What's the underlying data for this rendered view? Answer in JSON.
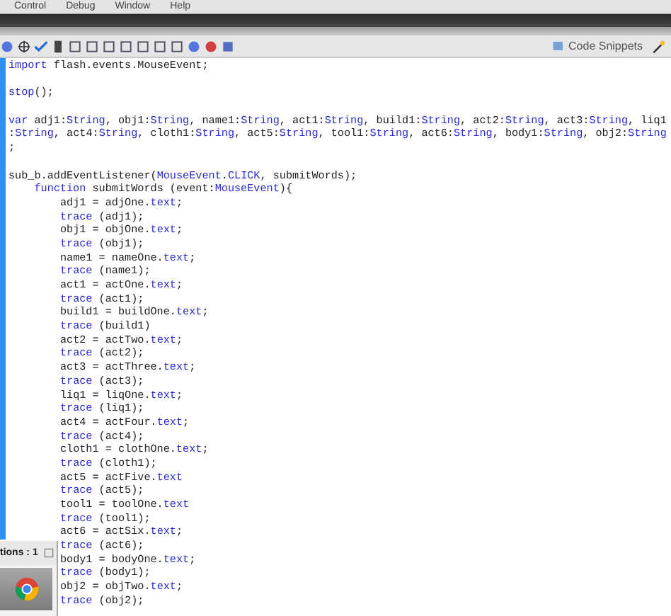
{
  "menu": [
    "Control",
    "Debug",
    "Window",
    "Help"
  ],
  "toolbar": {
    "snippets_label": "Code Snippets"
  },
  "code_blocks": [
    [
      {
        "segments": [
          {
            "text": "import",
            "keyword": true
          },
          {
            "text": " flash.events.MouseEvent;",
            "keyword": false
          }
        ]
      }
    ],
    [
      {
        "segments": [
          {
            "text": "stop",
            "keyword": true
          },
          {
            "text": "();",
            "keyword": false
          }
        ]
      }
    ],
    [
      {
        "segments": [
          {
            "text": "var",
            "keyword": true
          },
          {
            "text": " adj1:",
            "keyword": false
          },
          {
            "text": "String",
            "keyword": true
          },
          {
            "text": ", obj1:",
            "keyword": false
          },
          {
            "text": "String",
            "keyword": true
          },
          {
            "text": ", name1:",
            "keyword": false
          },
          {
            "text": "String",
            "keyword": true
          },
          {
            "text": ", act1:",
            "keyword": false
          },
          {
            "text": "String",
            "keyword": true
          },
          {
            "text": ", build1:",
            "keyword": false
          },
          {
            "text": "String",
            "keyword": true
          },
          {
            "text": ", act2:",
            "keyword": false
          },
          {
            "text": "String",
            "keyword": true
          },
          {
            "text": ", act3:",
            "keyword": false
          },
          {
            "text": "String",
            "keyword": true
          },
          {
            "text": ", liq1",
            "keyword": false
          }
        ]
      },
      {
        "segments": [
          {
            "text": ":",
            "keyword": false
          },
          {
            "text": "String",
            "keyword": true
          },
          {
            "text": ", act4:",
            "keyword": false
          },
          {
            "text": "String",
            "keyword": true
          },
          {
            "text": ", cloth1:",
            "keyword": false
          },
          {
            "text": "String",
            "keyword": true
          },
          {
            "text": ", act5:",
            "keyword": false
          },
          {
            "text": "String",
            "keyword": true
          },
          {
            "text": ", tool1:",
            "keyword": false
          },
          {
            "text": "String",
            "keyword": true
          },
          {
            "text": ", act6:",
            "keyword": false
          },
          {
            "text": "String",
            "keyword": true
          },
          {
            "text": ", body1:",
            "keyword": false
          },
          {
            "text": "String",
            "keyword": true
          },
          {
            "text": ", obj2:",
            "keyword": false
          },
          {
            "text": "String",
            "keyword": true
          }
        ]
      },
      {
        "segments": [
          {
            "text": ";",
            "keyword": false
          }
        ]
      }
    ],
    [
      {
        "segments": [
          {
            "text": "sub_b.addEventListener(",
            "keyword": false
          },
          {
            "text": "MouseEvent",
            "keyword": true
          },
          {
            "text": ".",
            "keyword": false
          },
          {
            "text": "CLICK",
            "keyword": true
          },
          {
            "text": ", submitWords);",
            "keyword": false
          }
        ],
        "children": [
          {
            "segments": [
              {
                "text": "function",
                "keyword": true
              },
              {
                "text": " submitWords (event:",
                "keyword": false
              },
              {
                "text": "MouseEvent",
                "keyword": true
              },
              {
                "text": "){",
                "keyword": false
              }
            ],
            "children": [
              {
                "segments": [
                  {
                    "text": "adj1 = adjOne.",
                    "keyword": false
                  },
                  {
                    "text": "text",
                    "keyword": true
                  },
                  {
                    "text": ";",
                    "keyword": false
                  }
                ]
              },
              {
                "segments": [
                  {
                    "text": "trace",
                    "keyword": true
                  },
                  {
                    "text": " (adj1);",
                    "keyword": false
                  }
                ]
              },
              {
                "segments": [
                  {
                    "text": "obj1 = objOne.",
                    "keyword": false
                  },
                  {
                    "text": "text",
                    "keyword": true
                  },
                  {
                    "text": ";",
                    "keyword": false
                  }
                ]
              },
              {
                "segments": [
                  {
                    "text": "trace",
                    "keyword": true
                  },
                  {
                    "text": " (obj1);",
                    "keyword": false
                  }
                ]
              },
              {
                "segments": [
                  {
                    "text": "name1 = nameOne.",
                    "keyword": false
                  },
                  {
                    "text": "text",
                    "keyword": true
                  },
                  {
                    "text": ";",
                    "keyword": false
                  }
                ]
              },
              {
                "segments": [
                  {
                    "text": "trace",
                    "keyword": true
                  },
                  {
                    "text": " (name1);",
                    "keyword": false
                  }
                ]
              },
              {
                "segments": [
                  {
                    "text": "act1 = actOne.",
                    "keyword": false
                  },
                  {
                    "text": "text",
                    "keyword": true
                  },
                  {
                    "text": ";",
                    "keyword": false
                  }
                ]
              },
              {
                "segments": [
                  {
                    "text": "trace",
                    "keyword": true
                  },
                  {
                    "text": " (act1);",
                    "keyword": false
                  }
                ]
              },
              {
                "segments": [
                  {
                    "text": "build1 = buildOne.",
                    "keyword": false
                  },
                  {
                    "text": "text",
                    "keyword": true
                  },
                  {
                    "text": ";",
                    "keyword": false
                  }
                ]
              },
              {
                "segments": [
                  {
                    "text": "trace",
                    "keyword": true
                  },
                  {
                    "text": " (build1)",
                    "keyword": false
                  }
                ]
              },
              {
                "segments": [
                  {
                    "text": "act2 = actTwo.",
                    "keyword": false
                  },
                  {
                    "text": "text",
                    "keyword": true
                  },
                  {
                    "text": ";",
                    "keyword": false
                  }
                ]
              },
              {
                "segments": [
                  {
                    "text": "trace",
                    "keyword": true
                  },
                  {
                    "text": " (act2);",
                    "keyword": false
                  }
                ]
              },
              {
                "segments": [
                  {
                    "text": "act3 = actThree.",
                    "keyword": false
                  },
                  {
                    "text": "text",
                    "keyword": true
                  },
                  {
                    "text": ";",
                    "keyword": false
                  }
                ]
              },
              {
                "segments": [
                  {
                    "text": "trace",
                    "keyword": true
                  },
                  {
                    "text": " (act3);",
                    "keyword": false
                  }
                ]
              },
              {
                "segments": [
                  {
                    "text": "liq1 = liqOne.",
                    "keyword": false
                  },
                  {
                    "text": "text",
                    "keyword": true
                  },
                  {
                    "text": ";",
                    "keyword": false
                  }
                ]
              },
              {
                "segments": [
                  {
                    "text": "trace",
                    "keyword": true
                  },
                  {
                    "text": " (liq1);",
                    "keyword": false
                  }
                ]
              },
              {
                "segments": [
                  {
                    "text": "act4 = actFour.",
                    "keyword": false
                  },
                  {
                    "text": "text",
                    "keyword": true
                  },
                  {
                    "text": ";",
                    "keyword": false
                  }
                ]
              },
              {
                "segments": [
                  {
                    "text": "trace",
                    "keyword": true
                  },
                  {
                    "text": " (act4);",
                    "keyword": false
                  }
                ]
              },
              {
                "segments": [
                  {
                    "text": "cloth1 = clothOne.",
                    "keyword": false
                  },
                  {
                    "text": "text",
                    "keyword": true
                  },
                  {
                    "text": ";",
                    "keyword": false
                  }
                ]
              },
              {
                "segments": [
                  {
                    "text": "trace",
                    "keyword": true
                  },
                  {
                    "text": " (cloth1);",
                    "keyword": false
                  }
                ]
              },
              {
                "segments": [
                  {
                    "text": "act5 = actFive.",
                    "keyword": false
                  },
                  {
                    "text": "text",
                    "keyword": true
                  }
                ]
              },
              {
                "segments": [
                  {
                    "text": "trace",
                    "keyword": true
                  },
                  {
                    "text": " (act5);",
                    "keyword": false
                  }
                ]
              },
              {
                "segments": [
                  {
                    "text": "tool1 = toolOne.",
                    "keyword": false
                  },
                  {
                    "text": "text",
                    "keyword": true
                  }
                ]
              },
              {
                "segments": [
                  {
                    "text": "trace",
                    "keyword": true
                  },
                  {
                    "text": " (tool1);",
                    "keyword": false
                  }
                ]
              },
              {
                "segments": [
                  {
                    "text": "act6 = actSix.",
                    "keyword": false
                  },
                  {
                    "text": "text",
                    "keyword": true
                  },
                  {
                    "text": ";",
                    "keyword": false
                  }
                ]
              },
              {
                "segments": [
                  {
                    "text": "trace",
                    "keyword": true
                  },
                  {
                    "text": " (act6);",
                    "keyword": false
                  }
                ]
              },
              {
                "segments": [
                  {
                    "text": "body1 = bodyOne.",
                    "keyword": false
                  },
                  {
                    "text": "text",
                    "keyword": true
                  },
                  {
                    "text": ";",
                    "keyword": false
                  }
                ]
              },
              {
                "segments": [
                  {
                    "text": "trace",
                    "keyword": true
                  },
                  {
                    "text": " (body1);",
                    "keyword": false
                  }
                ]
              },
              {
                "segments": [
                  {
                    "text": "obj2 = objTwo.",
                    "keyword": false
                  },
                  {
                    "text": "text",
                    "keyword": true
                  },
                  {
                    "text": ";",
                    "keyword": false
                  }
                ]
              },
              {
                "segments": [
                  {
                    "text": "trace",
                    "keyword": true
                  },
                  {
                    "text": " (obj2);",
                    "keyword": false
                  }
                ]
              }
            ]
          }
        ]
      }
    ]
  ],
  "overlay_window": {
    "label": "tions : 1"
  }
}
